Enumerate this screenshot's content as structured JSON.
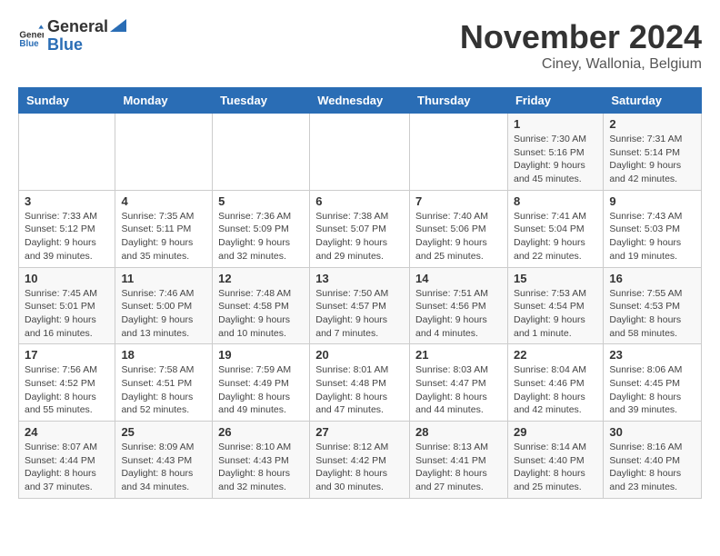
{
  "logo": {
    "text_general": "General",
    "text_blue": "Blue"
  },
  "title": "November 2024",
  "location": "Ciney, Wallonia, Belgium",
  "days_of_week": [
    "Sunday",
    "Monday",
    "Tuesday",
    "Wednesday",
    "Thursday",
    "Friday",
    "Saturday"
  ],
  "weeks": [
    [
      {
        "day": "",
        "info": ""
      },
      {
        "day": "",
        "info": ""
      },
      {
        "day": "",
        "info": ""
      },
      {
        "day": "",
        "info": ""
      },
      {
        "day": "",
        "info": ""
      },
      {
        "day": "1",
        "info": "Sunrise: 7:30 AM\nSunset: 5:16 PM\nDaylight: 9 hours and 45 minutes."
      },
      {
        "day": "2",
        "info": "Sunrise: 7:31 AM\nSunset: 5:14 PM\nDaylight: 9 hours and 42 minutes."
      }
    ],
    [
      {
        "day": "3",
        "info": "Sunrise: 7:33 AM\nSunset: 5:12 PM\nDaylight: 9 hours and 39 minutes."
      },
      {
        "day": "4",
        "info": "Sunrise: 7:35 AM\nSunset: 5:11 PM\nDaylight: 9 hours and 35 minutes."
      },
      {
        "day": "5",
        "info": "Sunrise: 7:36 AM\nSunset: 5:09 PM\nDaylight: 9 hours and 32 minutes."
      },
      {
        "day": "6",
        "info": "Sunrise: 7:38 AM\nSunset: 5:07 PM\nDaylight: 9 hours and 29 minutes."
      },
      {
        "day": "7",
        "info": "Sunrise: 7:40 AM\nSunset: 5:06 PM\nDaylight: 9 hours and 25 minutes."
      },
      {
        "day": "8",
        "info": "Sunrise: 7:41 AM\nSunset: 5:04 PM\nDaylight: 9 hours and 22 minutes."
      },
      {
        "day": "9",
        "info": "Sunrise: 7:43 AM\nSunset: 5:03 PM\nDaylight: 9 hours and 19 minutes."
      }
    ],
    [
      {
        "day": "10",
        "info": "Sunrise: 7:45 AM\nSunset: 5:01 PM\nDaylight: 9 hours and 16 minutes."
      },
      {
        "day": "11",
        "info": "Sunrise: 7:46 AM\nSunset: 5:00 PM\nDaylight: 9 hours and 13 minutes."
      },
      {
        "day": "12",
        "info": "Sunrise: 7:48 AM\nSunset: 4:58 PM\nDaylight: 9 hours and 10 minutes."
      },
      {
        "day": "13",
        "info": "Sunrise: 7:50 AM\nSunset: 4:57 PM\nDaylight: 9 hours and 7 minutes."
      },
      {
        "day": "14",
        "info": "Sunrise: 7:51 AM\nSunset: 4:56 PM\nDaylight: 9 hours and 4 minutes."
      },
      {
        "day": "15",
        "info": "Sunrise: 7:53 AM\nSunset: 4:54 PM\nDaylight: 9 hours and 1 minute."
      },
      {
        "day": "16",
        "info": "Sunrise: 7:55 AM\nSunset: 4:53 PM\nDaylight: 8 hours and 58 minutes."
      }
    ],
    [
      {
        "day": "17",
        "info": "Sunrise: 7:56 AM\nSunset: 4:52 PM\nDaylight: 8 hours and 55 minutes."
      },
      {
        "day": "18",
        "info": "Sunrise: 7:58 AM\nSunset: 4:51 PM\nDaylight: 8 hours and 52 minutes."
      },
      {
        "day": "19",
        "info": "Sunrise: 7:59 AM\nSunset: 4:49 PM\nDaylight: 8 hours and 49 minutes."
      },
      {
        "day": "20",
        "info": "Sunrise: 8:01 AM\nSunset: 4:48 PM\nDaylight: 8 hours and 47 minutes."
      },
      {
        "day": "21",
        "info": "Sunrise: 8:03 AM\nSunset: 4:47 PM\nDaylight: 8 hours and 44 minutes."
      },
      {
        "day": "22",
        "info": "Sunrise: 8:04 AM\nSunset: 4:46 PM\nDaylight: 8 hours and 42 minutes."
      },
      {
        "day": "23",
        "info": "Sunrise: 8:06 AM\nSunset: 4:45 PM\nDaylight: 8 hours and 39 minutes."
      }
    ],
    [
      {
        "day": "24",
        "info": "Sunrise: 8:07 AM\nSunset: 4:44 PM\nDaylight: 8 hours and 37 minutes."
      },
      {
        "day": "25",
        "info": "Sunrise: 8:09 AM\nSunset: 4:43 PM\nDaylight: 8 hours and 34 minutes."
      },
      {
        "day": "26",
        "info": "Sunrise: 8:10 AM\nSunset: 4:43 PM\nDaylight: 8 hours and 32 minutes."
      },
      {
        "day": "27",
        "info": "Sunrise: 8:12 AM\nSunset: 4:42 PM\nDaylight: 8 hours and 30 minutes."
      },
      {
        "day": "28",
        "info": "Sunrise: 8:13 AM\nSunset: 4:41 PM\nDaylight: 8 hours and 27 minutes."
      },
      {
        "day": "29",
        "info": "Sunrise: 8:14 AM\nSunset: 4:40 PM\nDaylight: 8 hours and 25 minutes."
      },
      {
        "day": "30",
        "info": "Sunrise: 8:16 AM\nSunset: 4:40 PM\nDaylight: 8 hours and 23 minutes."
      }
    ]
  ]
}
